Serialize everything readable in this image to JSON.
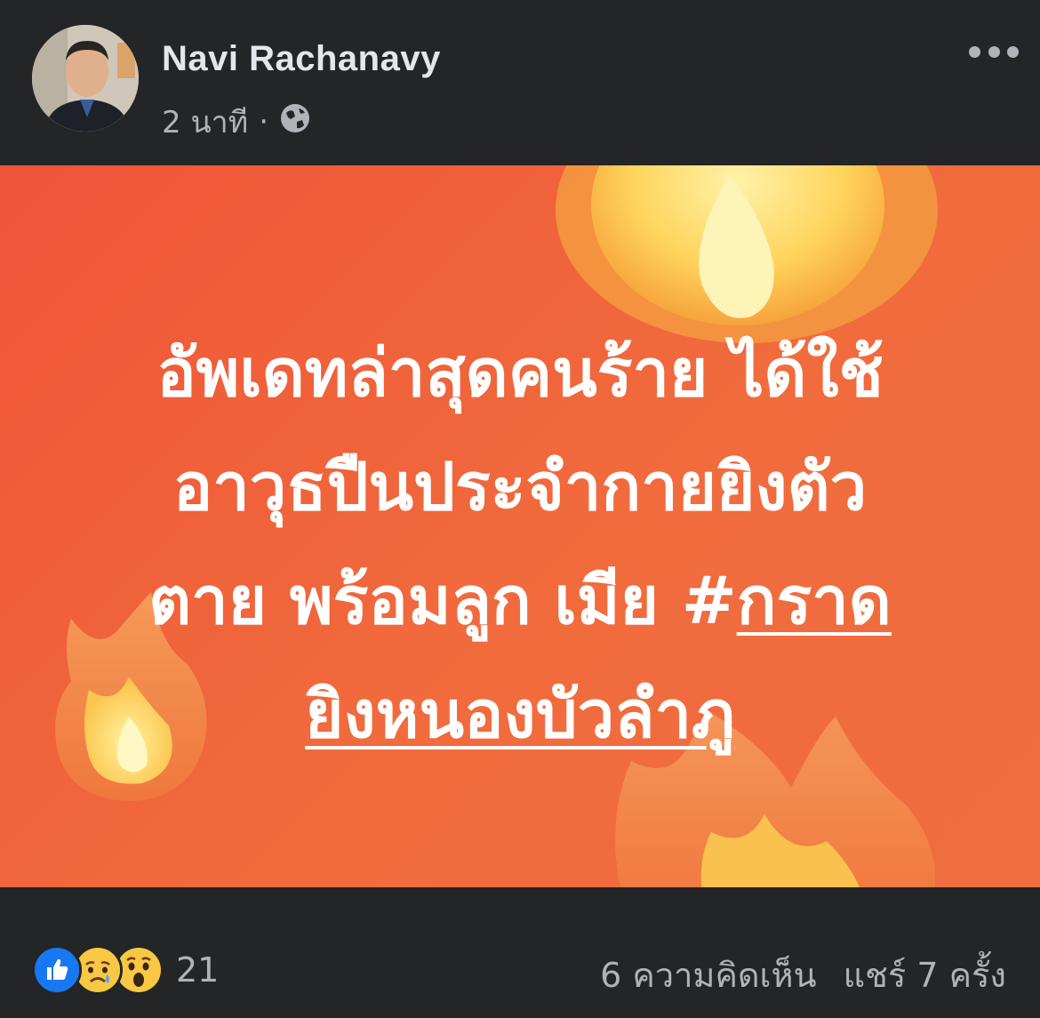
{
  "post": {
    "author_name": "Navi Rachanavy",
    "time": "2 นาที",
    "separator": "·",
    "audience_icon": "globe-icon",
    "more_icon": "more-options-icon",
    "text_lines": [
      "อัพเดทล่าสุดคนร้าย ได้ใช้",
      "อาวุธปืนประจำกายยิงตัว",
      "ตาย พร้อมลูก เมีย #",
      "กราด",
      "ยิงหนองบัวลำภู"
    ],
    "background_colors": [
      "#ef5537",
      "#f16b3d"
    ],
    "decoration_icons": [
      "fire-icon",
      "fire-icon",
      "fire-icon"
    ]
  },
  "footer": {
    "reaction_icons": [
      "like-icon",
      "sad-icon",
      "wow-icon"
    ],
    "reaction_count": "21",
    "comments": "6 ความคิดเห็น",
    "shares": "แชร์ 7 ครั้ง"
  }
}
